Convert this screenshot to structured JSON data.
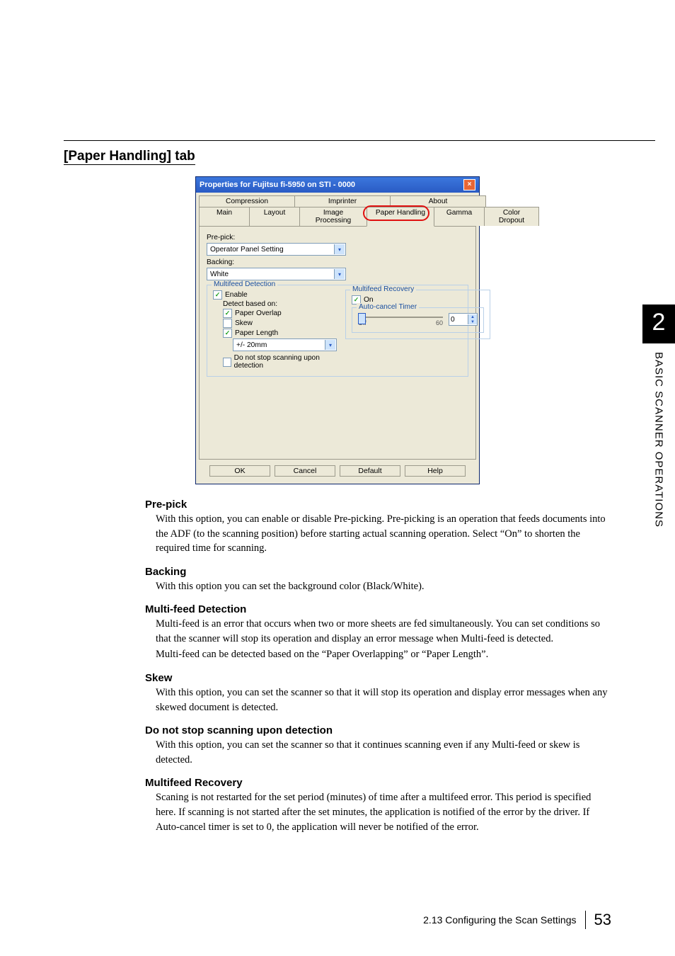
{
  "section_title": "[Paper Handling] tab",
  "dialog": {
    "title": "Properties for Fujitsu fi-5950 on STI - 0000",
    "tabs_back": [
      "Compression",
      "Imprinter",
      "About"
    ],
    "tabs_front": [
      "Main",
      "Layout",
      "Image Processing",
      "Paper Handling",
      "Gamma",
      "Color Dropout"
    ],
    "prepick_label": "Pre-pick:",
    "prepick_value": "Operator Panel Setting",
    "backing_label": "Backing:",
    "backing_value": "White",
    "mf_legend": "Multifeed Detection",
    "enable_label": "Enable",
    "detect_label": "Detect based on:",
    "paper_overlap": "Paper Overlap",
    "skew_opt": "Skew",
    "paper_length": "Paper Length",
    "paper_length_val": "+/- 20mm",
    "donot_stop": "Do not stop scanning upon detection",
    "mr_legend": "Multifeed Recovery",
    "on_label": "On",
    "ac_legend": "Auto-cancel Timer",
    "ac_value": "0",
    "ac_off": "Off",
    "ac_max": "60",
    "buttons": {
      "ok": "OK",
      "cancel": "Cancel",
      "default": "Default",
      "help": "Help"
    }
  },
  "descriptions": {
    "prepick": {
      "h": "Pre-pick",
      "p": "With this option, you can enable or disable Pre-picking. Pre-picking is an operation that feeds documents into the ADF (to the scanning position) before starting actual scanning operation. Select “On” to shorten the required time for scanning."
    },
    "backing": {
      "h": "Backing",
      "p": "With this option you can set the background color (Black/White)."
    },
    "multifeed": {
      "h": "Multi-feed Detection",
      "p1": "Multi-feed is an error that occurs when two or more sheets are fed simultaneously. You can set conditions so that the scanner will stop its operation and display an error message when Multi-feed is detected.",
      "p2": "Multi-feed can be detected based on the “Paper Overlapping” or “Paper Length”."
    },
    "skew": {
      "h": "Skew",
      "p": "With this option, you can set the scanner so that it will stop its operation and display error messages when any skewed document is detected."
    },
    "donotstop": {
      "h": "Do not stop scanning upon detection",
      "p": "With this option, you can set the scanner so that it continues scanning even if any Multi-feed or skew is detected."
    },
    "mfrecovery": {
      "h": "Multifeed Recovery",
      "p": "Scaning is not restarted for the set period (minutes) of time after a multifeed error. This period is specified here. If scanning is not started after the set minutes, the application is notified of the error by the driver. If Auto-cancel timer is set to 0, the application will never be notified of the error."
    }
  },
  "side": {
    "chapter": "2",
    "label": "BASIC SCANNER OPERATIONS"
  },
  "footer": {
    "text": "2.13 Configuring the Scan Settings",
    "page": "53"
  }
}
